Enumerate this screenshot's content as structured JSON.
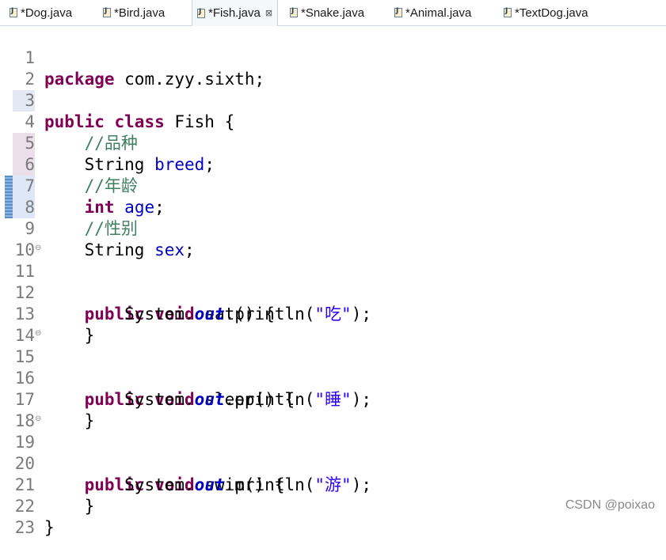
{
  "tabs": [
    {
      "label": "*Dog.java",
      "active": false
    },
    {
      "label": "*Bird.java",
      "active": false
    },
    {
      "label": "*Fish.java",
      "active": true,
      "close": "⊠"
    },
    {
      "label": "*Snake.java",
      "active": false
    },
    {
      "label": "*Animal.java",
      "active": false
    },
    {
      "label": "*TextDog.java",
      "active": false
    }
  ],
  "editor": {
    "lines": [
      {
        "n": "1"
      },
      {
        "n": "2"
      },
      {
        "n": "3"
      },
      {
        "n": "4"
      },
      {
        "n": "5"
      },
      {
        "n": "6"
      },
      {
        "n": "7"
      },
      {
        "n": "8"
      },
      {
        "n": "9"
      },
      {
        "n": "10"
      },
      {
        "n": "11",
        "fold": "⊖"
      },
      {
        "n": "12"
      },
      {
        "n": "13"
      },
      {
        "n": "14"
      },
      {
        "n": "15",
        "fold": "⊖"
      },
      {
        "n": "16"
      },
      {
        "n": "17"
      },
      {
        "n": "18"
      },
      {
        "n": "19",
        "fold": "⊖"
      },
      {
        "n": "20"
      },
      {
        "n": "21"
      },
      {
        "n": "22"
      },
      {
        "n": "23"
      }
    ],
    "code": {
      "l1": {
        "kw": "package",
        "rest": " com.zyy.sixth;"
      },
      "l3": {
        "kw1": "public",
        "kw2": "class",
        "rest": " Fish {"
      },
      "l4": {
        "cmt": "//品种"
      },
      "l5": {
        "type": "String",
        "field": "breed",
        "semi": ";"
      },
      "l6": {
        "cmt": "//年龄"
      },
      "l7": {
        "kw": "int",
        "field": "age",
        "semi": ";"
      },
      "l8": {
        "cmt": "//性别"
      },
      "l9": {
        "type": "String",
        "field": "sex",
        "semi": ";"
      },
      "l11": {
        "kw1": "public",
        "kw2": "void",
        "rest": " eat() {"
      },
      "l12": {
        "pre": "System.",
        "stat": "out",
        "mid": ".println(",
        "str": "\"吃\"",
        "end": ");"
      },
      "l13": {
        "rest": "}"
      },
      "l15": {
        "kw1": "public",
        "kw2": "void",
        "rest": " sleep() {"
      },
      "l16": {
        "pre": "System.",
        "stat": "out",
        "mid": ".println(",
        "str": "\"睡\"",
        "end": ");"
      },
      "l17": {
        "rest": "}"
      },
      "l19": {
        "kw1": "public",
        "kw2": "void",
        "rest": " swim() {"
      },
      "l20": {
        "pre": "System.",
        "stat": "out",
        "mid": ".println(",
        "str": "\"游\"",
        "end": ");"
      },
      "l21": {
        "rest": "}"
      },
      "l22": {
        "rest": "}"
      }
    }
  },
  "watermark": "CSDN @poixao",
  "colors": {
    "keyword": "#7f0055",
    "field": "#0000c0",
    "string": "#2a00ff",
    "comment": "#3f7f5f",
    "line_number": "#7a7a7a"
  },
  "icons": {
    "tab_file": "java-file-icon",
    "tab_close": "close-icon",
    "fold": "collapse-icon"
  }
}
